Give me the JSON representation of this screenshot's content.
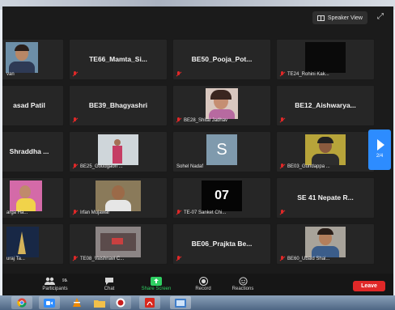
{
  "header": {
    "speaker_view_label": "Speaker View"
  },
  "tiles": [
    {
      "big": "",
      "small": "van"
    },
    {
      "big": "TE66_Mamta_Si...",
      "small": ""
    },
    {
      "big": "BE50_Pooja_Pot...",
      "small": ""
    },
    {
      "big": "",
      "small": "TE24_Rohini Kak..."
    },
    {
      "big": "asad Patil",
      "small": ""
    },
    {
      "big": "BE39_Bhagyashri",
      "small": ""
    },
    {
      "big": "",
      "small": "BE28_Shital Jadhav"
    },
    {
      "big": "BE12_Aishwarya...",
      "small": ""
    },
    {
      "big": "Shraddha ...",
      "small": ""
    },
    {
      "big": "",
      "small": "BE25_Goudgaon ..."
    },
    {
      "big": "",
      "small": "Sohel Nadaf",
      "avatar_letter": "S"
    },
    {
      "big": "",
      "small": "BE03_Gundappa ..."
    },
    {
      "big": "",
      "small": "arga Ha..."
    },
    {
      "big": "",
      "small": "Irfan Mujawar"
    },
    {
      "big": "",
      "small": "TE-07 Sanket Chi...",
      "avatar_text": "07"
    },
    {
      "big": "SE 41 Nepate R...",
      "small": ""
    },
    {
      "big": "",
      "small": "uraj Ta..."
    },
    {
      "big": "",
      "small": "TE08_Vaishnavi C..."
    },
    {
      "big": "BE06_Prajkta Be...",
      "small": ""
    },
    {
      "big": "",
      "small": "BE60_Ubaid Shai..."
    }
  ],
  "pager": {
    "label": "2/4"
  },
  "toolbar": {
    "participants_label": "Participants",
    "participants_count": "98",
    "chat_label": "Chat",
    "share_label": "Share Screen",
    "record_label": "Record",
    "reactions_label": "Reactions",
    "leave_label": "Leave"
  },
  "colors": {
    "background": "#1b1b1b",
    "tile": "#262626",
    "accent": "#2d8cff",
    "leave": "#e02828",
    "share": "#2fcf62"
  }
}
